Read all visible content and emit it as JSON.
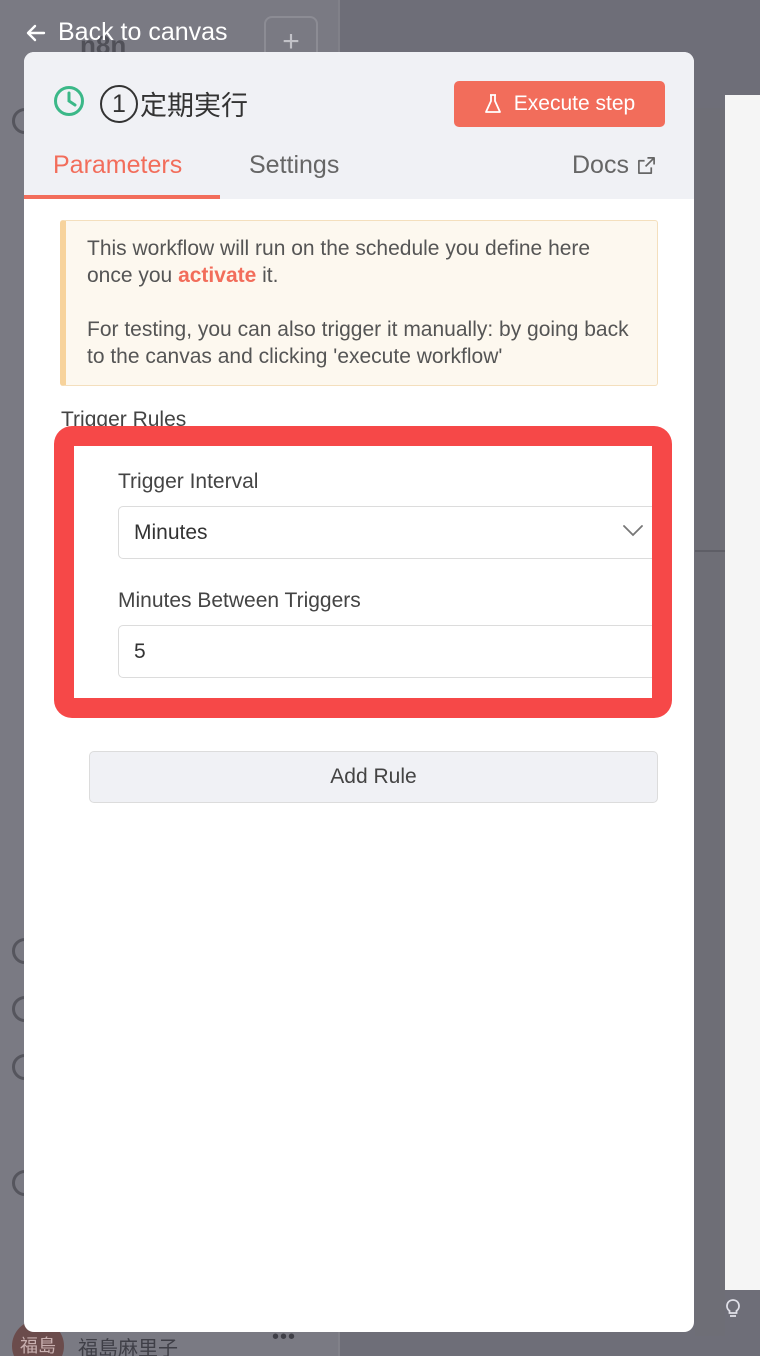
{
  "background": {
    "logo_text": "n8n",
    "user_avatar_initials": "福島",
    "user_name": "福島麻里子",
    "more_label": "•••",
    "plus_label": "+"
  },
  "back_link": {
    "label": "Back to canvas"
  },
  "node": {
    "number": "1",
    "title": "定期実行",
    "icon": "clock-icon",
    "accent_color": "#3bb888"
  },
  "execute_button": {
    "label": "Execute step",
    "icon": "flask-icon",
    "color": "#f26d5b"
  },
  "tabs": [
    {
      "label": "Parameters",
      "active": true
    },
    {
      "label": "Settings",
      "active": false
    }
  ],
  "docs": {
    "label": "Docs",
    "icon": "external-link-icon"
  },
  "notice": {
    "line1_before": "This workflow will run on the schedule you define here once you",
    "activate_link": "activate",
    "line1_after": "it.",
    "line2": "For testing, you can also trigger it manually: by going back to the canvas and clicking 'execute workflow'"
  },
  "trigger_rules": {
    "title": "Trigger Rules",
    "interval_label": "Trigger Interval",
    "interval_value": "Minutes",
    "minutes_label": "Minutes Between Triggers",
    "minutes_value": "5",
    "highlight_color": "#f64848"
  },
  "add_rule_button": {
    "label": "Add Rule"
  }
}
